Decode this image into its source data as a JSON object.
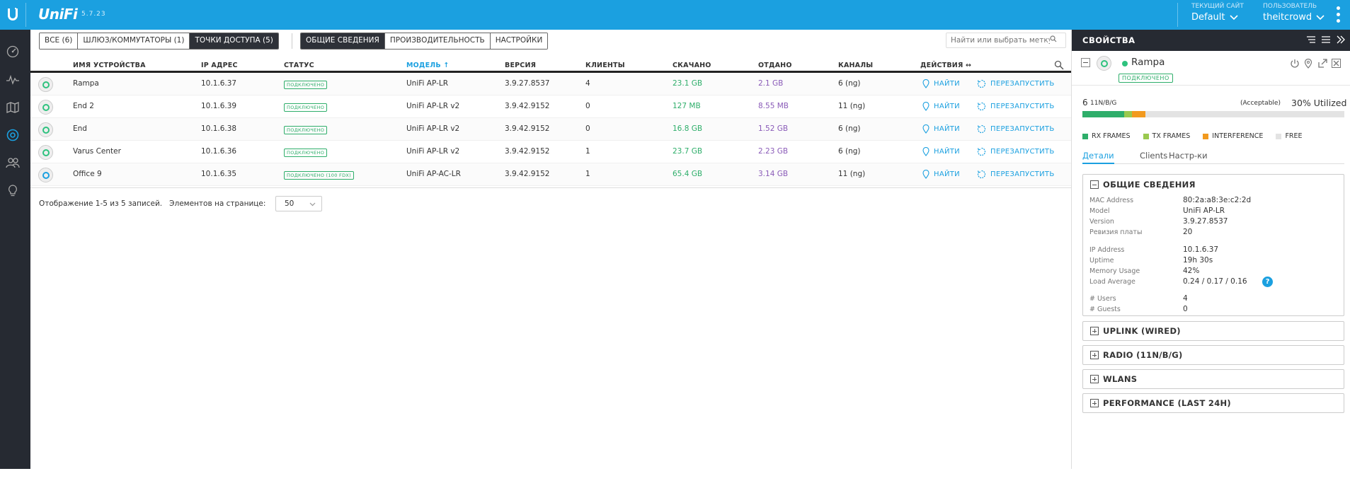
{
  "app": {
    "logo": "UniFi",
    "version": "5.7.23",
    "site_label": "ТЕКУЩИЙ САЙТ",
    "site_value": "Default",
    "user_label": "ПОЛЬЗОВАТЕЛЬ",
    "user_value": "theitcrowd"
  },
  "filters": {
    "all": "ВСЕ (6)",
    "gateways": "ШЛЮЗ/КОММУТАТОРЫ (1)",
    "access_points": "ТОЧКИ ДОСТУПА (5)",
    "overview": "ОБЩИЕ СВЕДЕНИЯ",
    "performance": "ПРОИЗВОДИТЕЛЬНОСТЬ",
    "settings": "НАСТРОЙКИ",
    "search_placeholder": "Найти или выбрать метку"
  },
  "table": {
    "headers": {
      "name": "ИМЯ УСТРОЙСТВА",
      "ip": "IP АДРЕС",
      "status": "СТАТУС",
      "model": "МОДЕЛЬ ↑",
      "version": "ВЕРСИЯ",
      "clients": "КЛИЕНТЫ",
      "down": "СКАЧАНО",
      "up": "ОТДАНО",
      "channels": "КАНАЛЫ",
      "actions": "ДЕЙСТВИЯ ↔"
    },
    "locate": "НАЙТИ",
    "restart": "ПЕРЕЗАПУСТИТЬ",
    "rows": [
      {
        "name": "Rampa",
        "ip": "10.1.6.37",
        "status": "ПОДКЛЮЧЕНО",
        "model": "UniFi AP-LR",
        "version": "3.9.27.8537",
        "clients": "4",
        "down": "23.1 GB",
        "up": "2.1 GB",
        "channels": "6 (ng)"
      },
      {
        "name": "End 2",
        "ip": "10.1.6.39",
        "status": "ПОДКЛЮЧЕНО",
        "model": "UniFi AP-LR v2",
        "version": "3.9.42.9152",
        "clients": "0",
        "down": "127 MB",
        "up": "8.55 MB",
        "channels": "11 (ng)"
      },
      {
        "name": "End",
        "ip": "10.1.6.38",
        "status": "ПОДКЛЮЧЕНО",
        "model": "UniFi AP-LR v2",
        "version": "3.9.42.9152",
        "clients": "0",
        "down": "16.8 GB",
        "up": "1.52 GB",
        "channels": "6 (ng)"
      },
      {
        "name": "Varus Center",
        "ip": "10.1.6.36",
        "status": "ПОДКЛЮЧЕНО",
        "model": "UniFi AP-LR v2",
        "version": "3.9.42.9152",
        "clients": "1",
        "down": "23.7 GB",
        "up": "2.23 GB",
        "channels": "6 (ng)"
      },
      {
        "name": "Office 9",
        "ip": "10.1.6.35",
        "status": "ПОДКЛЮЧЕНО (100 FDX)",
        "model": "UniFi AP-AC-LR",
        "version": "3.9.42.9152",
        "clients": "1",
        "down": "65.4 GB",
        "up": "3.14 GB",
        "channels": "11 (ng)"
      }
    ],
    "footer_text": "Отображение 1-5 из 5 записей.   Элементов на странице:",
    "page_size": "50"
  },
  "panel": {
    "title": "СВОЙСТВА",
    "device_name": "Rampa",
    "device_status": "ПОДКЛЮЧЕНО",
    "radio_channel": "6",
    "radio_band": "11N/B/G",
    "quality": "(Acceptable)",
    "utilized": "30% Utilized",
    "utilization": {
      "rx": 0.16,
      "tx": 0.03,
      "interference": 0.05
    },
    "colors": {
      "rx": "#2eae6a",
      "tx": "#9ac94f",
      "interference": "#f29a1f",
      "free": "#e3e3e3"
    },
    "legend": {
      "rx": "RX FRAMES",
      "tx": "TX FRAMES",
      "interference": "INTERFERENCE",
      "free": "FREE"
    },
    "tabs": [
      "Детали",
      "Clients",
      "Настр-ки"
    ],
    "overview_title": "ОБЩИЕ СВЕДЕНИЯ",
    "details": [
      {
        "k": "MAC Address",
        "v": "80:2a:a8:3e:c2:2d"
      },
      {
        "k": "Model",
        "v": "UniFi AP-LR"
      },
      {
        "k": "Version",
        "v": "3.9.27.8537"
      },
      {
        "k": "Ревизия платы",
        "v": "20"
      },
      {
        "k": "IP Address",
        "v": "10.1.6.37"
      },
      {
        "k": "Uptime",
        "v": "19h 30s"
      },
      {
        "k": "Memory Usage",
        "v": "42%"
      },
      {
        "k": "Load Average",
        "v": "0.24 / 0.17 / 0.16"
      },
      {
        "k": "# Users",
        "v": "4"
      },
      {
        "k": "# Guests",
        "v": "0"
      }
    ],
    "sections": [
      "UPLINK (WIRED)",
      "RADIO (11N/B/G)",
      "WLANS",
      "PERFORMANCE (LAST 24H)"
    ],
    "qmark": "?"
  }
}
